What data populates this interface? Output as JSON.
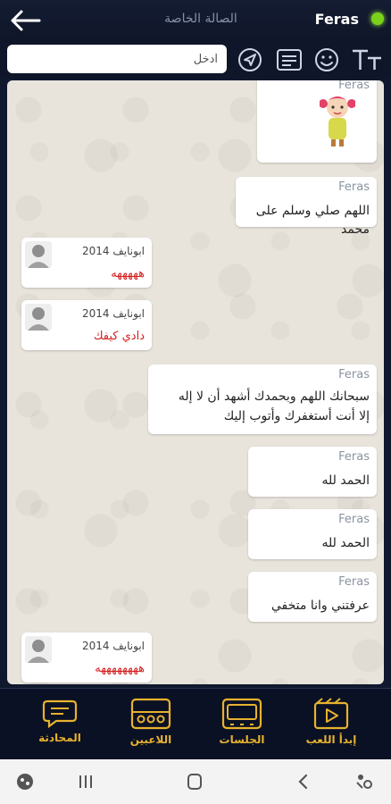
{
  "header": {
    "title": "الصالة الخاصة",
    "user": "Feras"
  },
  "toolbar": {
    "input_placeholder": "ادخل",
    "icons": [
      "text-size-icon",
      "emoji-icon",
      "message-icon",
      "send-icon"
    ]
  },
  "messages": [
    {
      "side": "right",
      "name": "Feras",
      "type": "sticker"
    },
    {
      "side": "right",
      "name": "Feras",
      "lines": [
        "اللهم صلي وسلم على محمد"
      ]
    },
    {
      "side": "left",
      "date": "ابونايف 2014",
      "lines": [
        "هههههه"
      ]
    },
    {
      "side": "left",
      "date": "ابونايف 2014",
      "lines": [
        "دادي كيفك"
      ]
    },
    {
      "side": "right",
      "name": "Feras",
      "lines": [
        "سبحانك اللهم وبحمدك أشهد أن لا إله",
        "إلا أنت أستغفرك وأتوب إليك"
      ]
    },
    {
      "side": "right",
      "name": "Feras",
      "lines": [
        "الحمد لله"
      ]
    },
    {
      "side": "right",
      "name": "Feras",
      "lines": [
        "الحمد لله"
      ]
    },
    {
      "side": "right",
      "name": "Feras",
      "lines": [
        "عرفتني وانا متخفي"
      ]
    },
    {
      "side": "left",
      "date": "ابونايف 2014",
      "lines": [
        "ههههههههه"
      ]
    }
  ],
  "nav": {
    "items": [
      {
        "label": "المحادثة",
        "icon": "chat-icon"
      },
      {
        "label": "اللاعبين",
        "icon": "players-icon"
      },
      {
        "label": "الجلسات",
        "icon": "sessions-icon"
      },
      {
        "label": "إبدأ اللعب",
        "icon": "play-icon"
      }
    ]
  },
  "colors": {
    "accent": "#e7b22e",
    "header_bg": "#0f1629",
    "online": "#7ad11a",
    "left_text": "#d21e1e"
  }
}
